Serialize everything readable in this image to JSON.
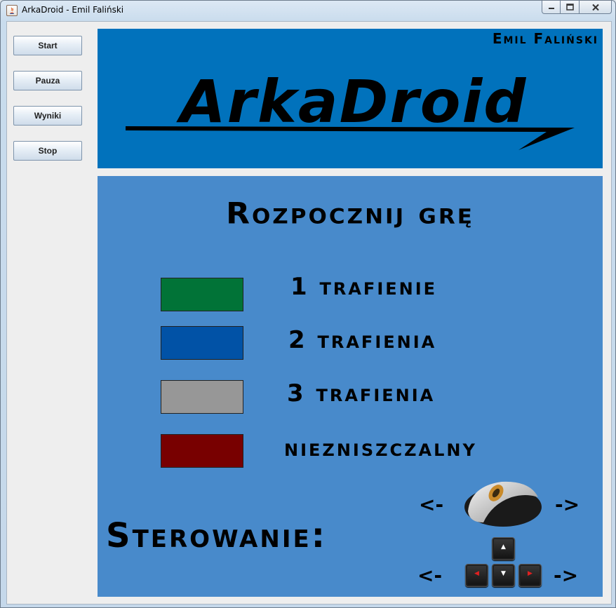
{
  "window": {
    "title": "ArkaDroid - Emil Faliński"
  },
  "sidebar": {
    "buttons": [
      {
        "label": "Start"
      },
      {
        "label": "Pauza"
      },
      {
        "label": "Wyniki"
      },
      {
        "label": "Stop"
      }
    ]
  },
  "header": {
    "author": "Emil Faliński",
    "logo_text": "ArkaDroid",
    "background": "#0172bc"
  },
  "main": {
    "title": "Rozpocznij grę",
    "background": "#488acb",
    "legend": [
      {
        "label": "1 trafienie",
        "color": "#017337"
      },
      {
        "label": "2 trafienia",
        "color": "#0152a6"
      },
      {
        "label": "3 trafienia",
        "color": "#979797"
      },
      {
        "label": "niezniszczalny",
        "color": "#780000"
      }
    ],
    "controls": {
      "title": "Sterowanie:",
      "left_arrow": "<-",
      "right_arrow": "->",
      "devices": [
        "mouse-icon",
        "arrow-keys-icon"
      ]
    }
  }
}
